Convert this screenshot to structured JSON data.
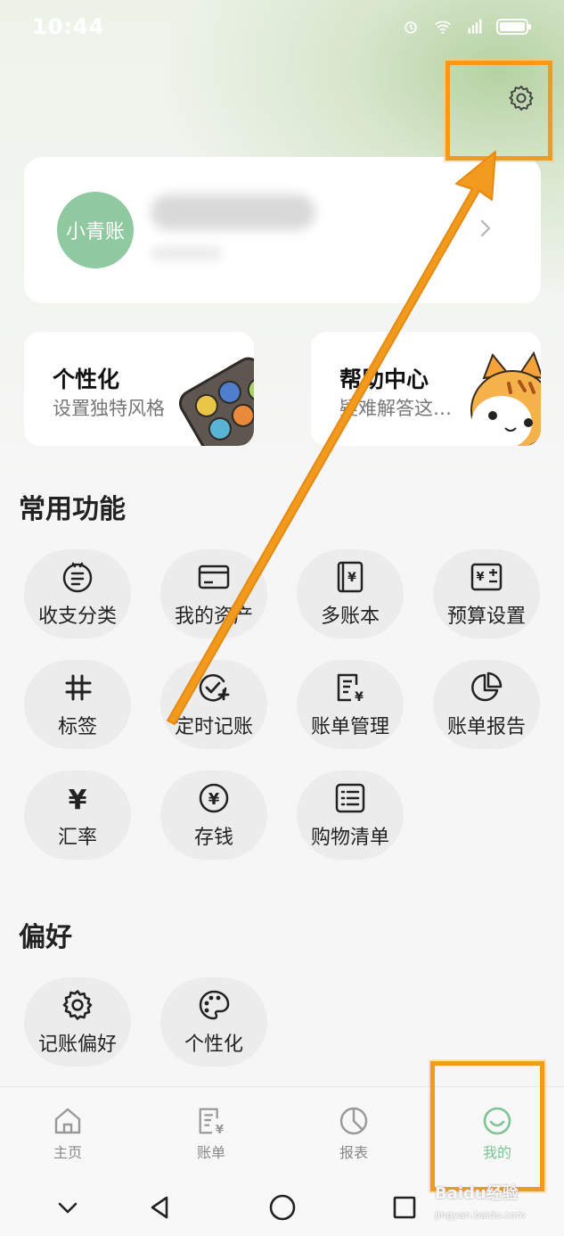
{
  "status_bar": {
    "time": "10:44",
    "icons": [
      "alarm-icon",
      "wifi-icon",
      "signal-icon",
      "battery-icon"
    ]
  },
  "header": {
    "settings_icon": "gear-icon"
  },
  "profile": {
    "avatar_text": "小青账"
  },
  "feature_cards": [
    {
      "title": "个性化",
      "subtitle": "设置独特风格"
    },
    {
      "title": "帮助中心",
      "subtitle": "疑难解答这…"
    }
  ],
  "common": {
    "title": "常用功能",
    "items": [
      {
        "label": "收支分类",
        "icon": "category-icon"
      },
      {
        "label": "我的资产",
        "icon": "card-icon"
      },
      {
        "label": "多账本",
        "icon": "ledger-icon"
      },
      {
        "label": "预算设置",
        "icon": "budget-icon"
      },
      {
        "label": "标签",
        "icon": "hashtag-icon"
      },
      {
        "label": "定时记账",
        "icon": "scheduled-check-icon"
      },
      {
        "label": "账单管理",
        "icon": "bill-manage-icon"
      },
      {
        "label": "账单报告",
        "icon": "pie-report-icon"
      },
      {
        "label": "汇率",
        "icon": "yen-icon"
      },
      {
        "label": "存钱",
        "icon": "yen-circle-icon"
      },
      {
        "label": "购物清单",
        "icon": "list-icon"
      }
    ]
  },
  "preferences": {
    "title": "偏好",
    "items": [
      {
        "label": "记账偏好",
        "icon": "gear-icon"
      },
      {
        "label": "个性化",
        "icon": "palette-icon"
      }
    ]
  },
  "tabbar": {
    "tabs": [
      {
        "label": "主页",
        "icon": "home-icon"
      },
      {
        "label": "账单",
        "icon": "bill-icon"
      },
      {
        "label": "报表",
        "icon": "report-icon"
      },
      {
        "label": "我的",
        "icon": "smile-icon"
      }
    ],
    "active_color": "#7cc493"
  },
  "annotation_color": "#f29a1e",
  "watermark": {
    "brand": "Baidu经验",
    "url": "jingyan.baidu.com"
  }
}
